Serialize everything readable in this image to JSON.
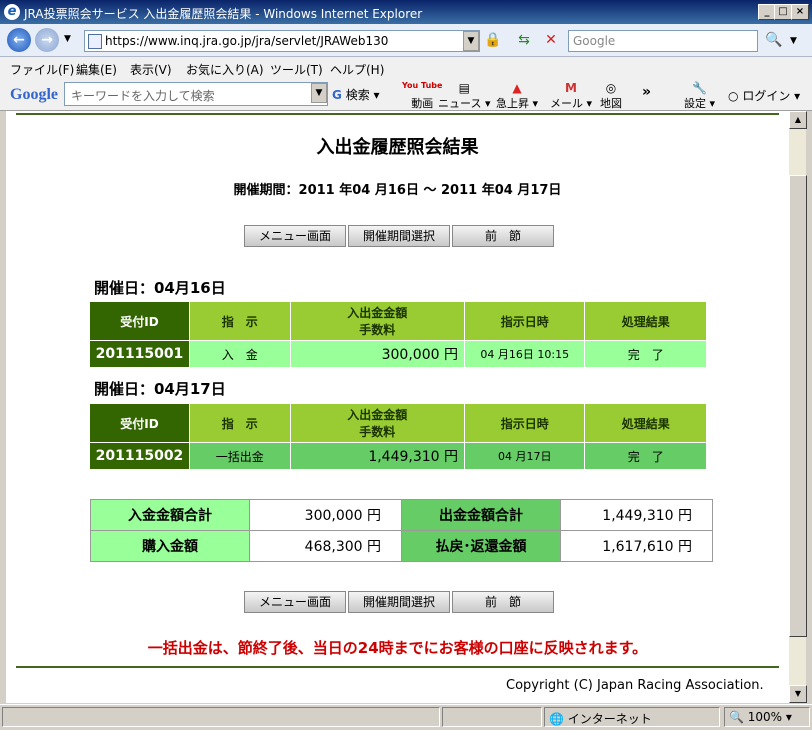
{
  "window": {
    "title": "JRA投票照会サービス 入出金履歴照会結果 - Windows Internet Explorer"
  },
  "address": {
    "url": "https://www.inq.jra.go.jp/jra/servlet/JRAWeb130",
    "search_placeholder": "Google"
  },
  "menu": {
    "items": [
      "ファイル(F)",
      "編集(E)",
      "表示(V)",
      "お気に入り(A)",
      "ツール(T)",
      "ヘルプ(H)"
    ]
  },
  "google_toolbar": {
    "logo": "Google",
    "search_placeholder": "キーワードを入力して検索",
    "search_label": "検索",
    "video": "動画",
    "video_logo": "You Tube",
    "news": "ニュース",
    "trending": "急上昇",
    "mail": "メール",
    "map": "地図",
    "more": "»",
    "settings": "設定",
    "login": "ログイン"
  },
  "page": {
    "title": "入出金履歴照会結果",
    "period": "開催期間：2011 年04 月16日 〜 2011 年04 月17日",
    "buttons": {
      "menu": "メニュー画面",
      "period_select": "開催期間選択",
      "prev": "前　節"
    },
    "table_headers": {
      "id": "受付ID",
      "instruction": "指　示",
      "amount_line1": "入出金金額",
      "amount_line2": "手数料",
      "datetime": "指示日時",
      "result": "処理結果"
    },
    "days": [
      {
        "label": "開催日：04月16日",
        "row": {
          "id": "201115001",
          "instruction": "入　金",
          "amount": "300,000 円",
          "datetime": "04 月16日 10:15",
          "result": "完　了"
        }
      },
      {
        "label": "開催日：04月17日",
        "row": {
          "id": "201115002",
          "instruction": "一括出金",
          "amount": "1,449,310 円",
          "datetime": "04 月17日",
          "result": "完　了"
        }
      }
    ],
    "summary": {
      "deposit_total_label": "入金金額合計",
      "deposit_total": "300,000 円",
      "withdraw_total_label": "出金金額合計",
      "withdraw_total": "1,449,310 円",
      "purchase_label": "購入金額",
      "purchase": "468,300 円",
      "refund_label": "払戻･返還金額",
      "refund": "1,617,610 円"
    },
    "notice": "一括出金は、節終了後、当日の24時までにお客様の口座に反映されます。",
    "copyright": "Copyright (C) Japan Racing Association."
  },
  "status": {
    "zone": "インターネット",
    "zoom": "100%"
  },
  "colors": {
    "accent_dark": "#336600",
    "header_green": "#99cc33",
    "row1": "#99ff99",
    "row2": "#66cc66",
    "notice": "#cc0000"
  }
}
